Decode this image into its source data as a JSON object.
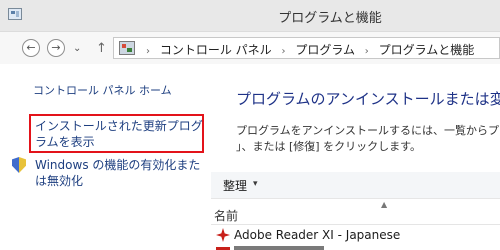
{
  "window": {
    "title": "プログラムと機能",
    "app_icon": "control-panel-icon"
  },
  "nav": {
    "back_icon": "back-arrow-icon",
    "forward_icon": "forward-arrow-icon",
    "back_glyph": "←",
    "forward_glyph": "→",
    "recent_glyph": "⌄",
    "up_glyph": "↑",
    "breadcrumb_sep": "›",
    "breadcrumb": [
      "コントロール パネル",
      "プログラム",
      "プログラムと機能"
    ]
  },
  "sidebar": {
    "home_link": "コントロール パネル ホーム",
    "installed_updates_link": "インストールされた更新プログラムを表示",
    "windows_features_link": "Windows の機能の有効化または無効化",
    "highlight_color": "#e3131a"
  },
  "main": {
    "title": "プログラムのアンインストールまたは変更",
    "description_line1": "プログラムをアンインストールするには、一覧からプログラム",
    "description_line2": "」、または [修復] をクリックします。",
    "organize_label": "整理",
    "organize_caret": "▾",
    "sort_caret": "▲",
    "column_name": "名前",
    "programs": [
      {
        "name": "Adobe Reader XI - Japanese",
        "icon": "adobe-reader-icon"
      }
    ]
  }
}
